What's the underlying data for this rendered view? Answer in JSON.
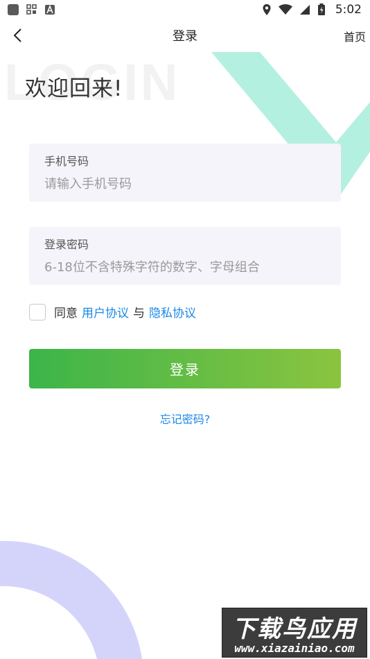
{
  "status_bar": {
    "time": "5:02",
    "left_icons": [
      "app-square-icon",
      "qr-grid-icon",
      "a-badge-icon"
    ],
    "right_icons": [
      "location-icon",
      "wifi-icon",
      "signal-icon",
      "battery-icon"
    ]
  },
  "header": {
    "title": "登录",
    "home_label": "首页"
  },
  "background_word": "LOGIN",
  "welcome": "欢迎回来!",
  "form": {
    "phone": {
      "label": "手机号码",
      "placeholder": "请输入手机号码",
      "value": ""
    },
    "password": {
      "label": "登录密码",
      "placeholder": "6-18位不含特殊字符的数字、字母组合",
      "value": ""
    }
  },
  "agreement": {
    "prefix": "同意",
    "user_agreement": "用户协议",
    "separator": "与",
    "privacy_policy": "隐私协议",
    "checked": false
  },
  "login_button": "登录",
  "forgot_password": "忘记密码?",
  "watermark": {
    "line1": "下载鸟应用",
    "line2": "www.xiazainiao.com"
  },
  "colors": {
    "accent_link": "#1a88e6",
    "button_gradient_start": "#3bb54a",
    "button_gradient_end": "#8bc43f",
    "deco_mint": "#b4f0e0",
    "deco_lavender": "#d4d4fb",
    "field_bg": "#f5f4fa"
  }
}
